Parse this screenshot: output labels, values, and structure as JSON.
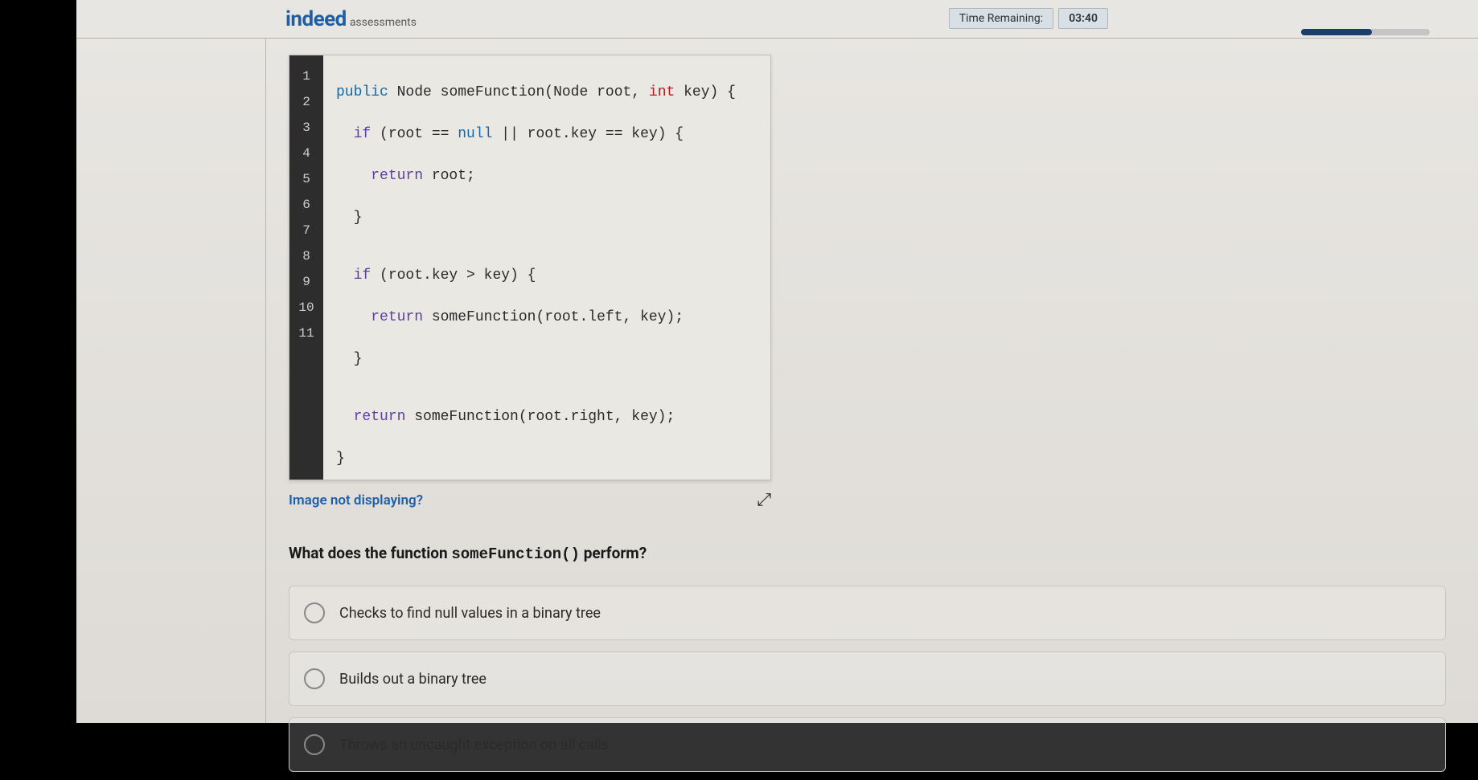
{
  "header": {
    "logo_primary": "indeed",
    "logo_secondary": "assessments",
    "time_label": "Time Remaining:",
    "time_value": "03:40"
  },
  "code": {
    "line_numbers": [
      "1",
      "2",
      "3",
      "4",
      "5",
      "6",
      "7",
      "8",
      "9",
      "10",
      "11"
    ],
    "l1": {
      "kw1": "public",
      "type": "Node",
      "fn": "someFunction",
      "p1": "(Node root, ",
      "kw2": "int",
      "p2": " key) {"
    },
    "l2": {
      "kw": "if",
      "c1": " (root == ",
      "null": "null",
      "c2": " || root.key == key) {"
    },
    "l3": {
      "kw": "return",
      "c": " root;"
    },
    "l4": "}",
    "l5": "",
    "l6": {
      "kw": "if",
      "c": " (root.key > key) {"
    },
    "l7": {
      "kw": "return",
      "c": " someFunction(root.left, key);"
    },
    "l8": "}",
    "l9": "",
    "l10": {
      "kw": "return",
      "c": " someFunction(root.right, key);"
    },
    "l11": "}"
  },
  "links": {
    "image_not_displaying": "Image not displaying?"
  },
  "question": {
    "prefix": "What does the function ",
    "func": "someFunction()",
    "suffix": " perform?"
  },
  "options": [
    "Checks to find null values in a binary tree",
    "Builds out a binary tree",
    "Throws an uncaught exception on all calls"
  ]
}
